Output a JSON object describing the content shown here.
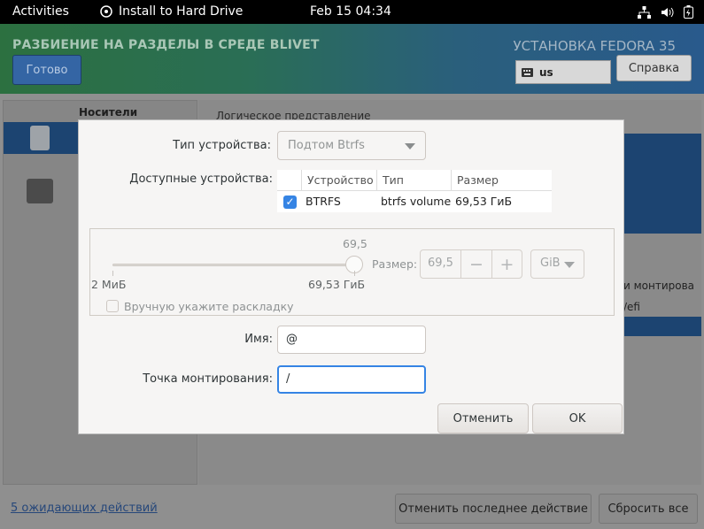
{
  "topbar": {
    "activities": "Activities",
    "app_name": "Install to Hard Drive",
    "clock": "Feb 15  04:34",
    "icons": [
      "network-icon",
      "volume-icon",
      "battery-icon"
    ]
  },
  "header": {
    "title": "РАЗБИЕНИЕ НА РАЗДЕЛЫ В СРЕДЕ BLIVET",
    "done_label": "Готово",
    "product": "УСТАНОВКА FEDORA 35",
    "keyboard_layout": "us",
    "help_label": "Справка"
  },
  "left_pane": {
    "label": "Носители"
  },
  "right_pane": {
    "header": "Логическое представление",
    "mount_col": "и монтирова",
    "efi": "/efi"
  },
  "dialog": {
    "device_type_label": "Тип устройства:",
    "device_type_value": "Подтом Btrfs",
    "available_label": "Доступные устройства:",
    "columns": [
      "Устройство",
      "Тип",
      "Размер"
    ],
    "rows": [
      {
        "device": "BTRFS",
        "type": "btrfs volume",
        "size": "69,53 ГиБ",
        "checked": true
      }
    ],
    "size": {
      "current": "69,5",
      "min": "2 МиБ",
      "max": "69,53 ГиБ",
      "size_label": "Размер:",
      "spin_value": "69,5",
      "minus": "−",
      "plus": "+",
      "unit": "GiB",
      "manual_label": "Вручную укажите раскладку"
    },
    "name_label": "Имя:",
    "name_value": "@",
    "mount_label": "Точка монтирования:",
    "mount_value": "/",
    "cancel_label": "Отменить",
    "ok_label": "OK"
  },
  "bottom": {
    "pending": "5 ожидающих действий",
    "undo_label": "Отменить последнее действие",
    "reset_label": "Сбросить все"
  }
}
